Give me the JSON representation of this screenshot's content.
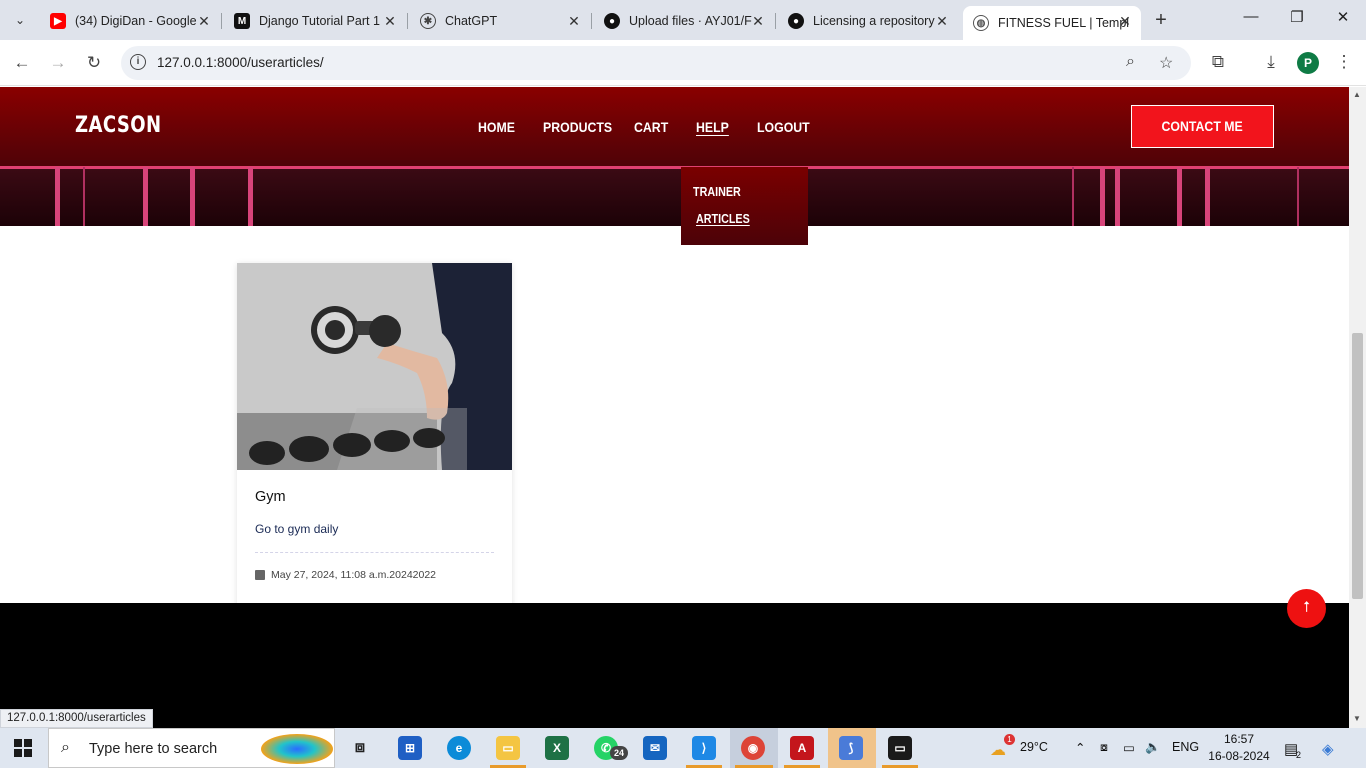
{
  "browser": {
    "tabs": [
      {
        "title": "(34) DigiDan - Google",
        "favicon": "youtube-icon"
      },
      {
        "title": "Django Tutorial Part 1",
        "favicon": "medium-icon"
      },
      {
        "title": "ChatGPT",
        "favicon": "chatgpt-icon"
      },
      {
        "title": "Upload files · AYJ01/F",
        "favicon": "github-icon"
      },
      {
        "title": "Licensing a repository",
        "favicon": "github-icon"
      },
      {
        "title": "FITNESS FUEL | Templ",
        "favicon": "globe-icon"
      }
    ],
    "active_tab": 5,
    "url": "127.0.0.1:8000/userarticles/",
    "status_url": "127.0.0.1:8000/userarticles",
    "profile_initial": "P"
  },
  "site": {
    "brand": "ZACSON",
    "nav": [
      "HOME",
      "PRODUCTS",
      "CART",
      "HELP",
      "LOGOUT"
    ],
    "contact_label": "CONTACT ME",
    "help_menu": [
      "TRAINER",
      "ARTICLES"
    ],
    "accent_color": "#f2141c"
  },
  "articles": [
    {
      "title": "Gym",
      "description": "Go to gym daily",
      "date": "May 27, 2024, 11:08 a.m.20242022",
      "image": "dumbbell-curl-photo"
    }
  ],
  "taskbar": {
    "search_placeholder": "Type here to search",
    "whatsapp_badge": "24",
    "weather": "29°C",
    "weather_badge": "1",
    "language": "ENG",
    "time": "16:57",
    "date": "16-08-2024",
    "notification_badge": "2"
  }
}
